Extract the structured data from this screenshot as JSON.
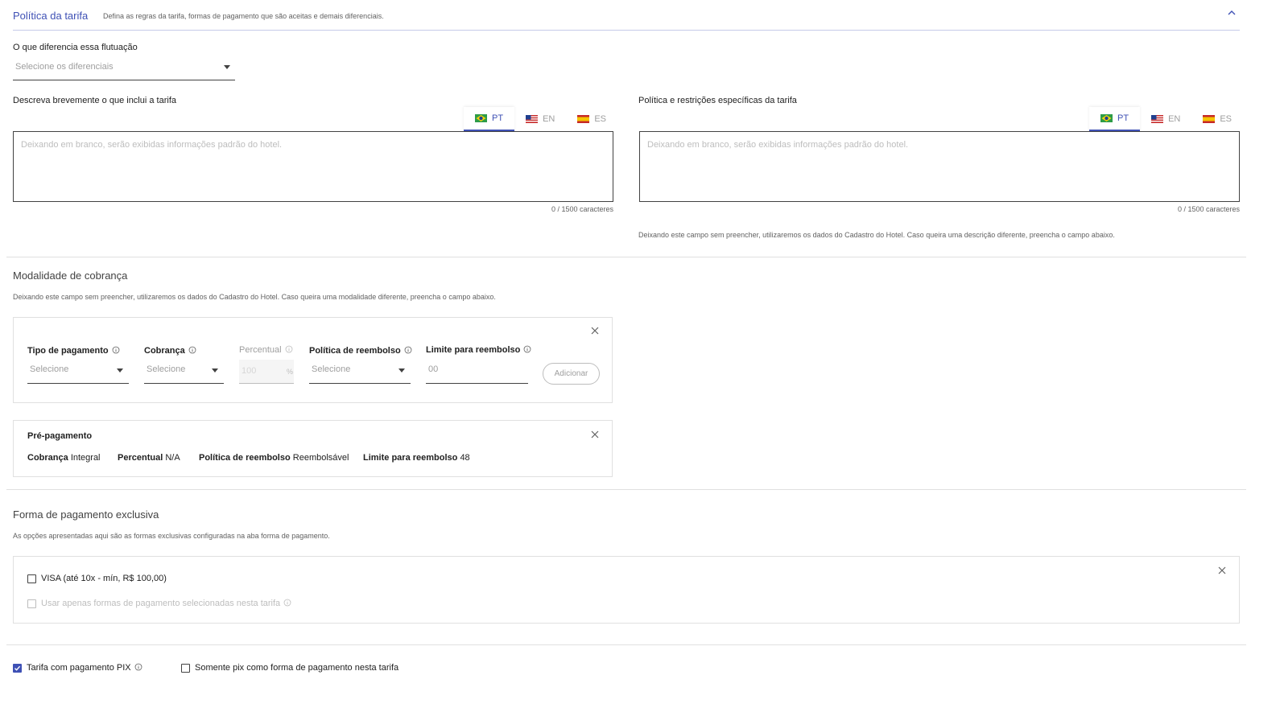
{
  "section": {
    "title": "Política da tarifa",
    "description": "Defina as regras da tarifa, formas de pagamento que são aceitas e demais diferenciais."
  },
  "diferenciais": {
    "label": "O que diferencia essa flutuação",
    "placeholder": "Selecione os diferenciais"
  },
  "descricao": {
    "label": "Descreva brevemente o que inclui a tarifa",
    "placeholder": "Deixando em branco, serão exibidas informações padrão do hotel.",
    "counter": "0 / 1500 caracteres"
  },
  "politica": {
    "label": "Política e restrições específicas da tarifa",
    "placeholder": "Deixando em branco, serão exibidas informações padrão do hotel.",
    "counter": "0 / 1500 caracteres",
    "note": "Deixando este campo sem preencher, utilizaremos os dados do Cadastro do Hotel. Caso queira uma descrição diferente, preencha o campo abaixo."
  },
  "languages": [
    {
      "code": "PT",
      "active": true
    },
    {
      "code": "EN",
      "active": false
    },
    {
      "code": "ES",
      "active": false
    }
  ],
  "modalidade": {
    "title": "Modalidade de cobrança",
    "note": "Deixando este campo sem preencher, utilizaremos os dados do Cadastro do Hotel. Caso queira uma modalidade diferente, preencha o campo abaixo.",
    "form": {
      "tipo_label": "Tipo de pagamento",
      "tipo_placeholder": "Selecione",
      "cobranca_label": "Cobrança",
      "cobranca_placeholder": "Selecione",
      "percentual_label": "Percentual",
      "percentual_value": "100",
      "percentual_unit": "%",
      "reembolso_label": "Política de reembolso",
      "reembolso_placeholder": "Selecione",
      "limite_label": "Limite para reembolso",
      "limite_placeholder": "00",
      "add_button": "Adicionar"
    },
    "item": {
      "title": "Pré-pagamento",
      "cobranca_key": "Cobrança",
      "cobranca_value": "Integral",
      "percentual_key": "Percentual",
      "percentual_value": "N/A",
      "reembolso_key": "Política de reembolso",
      "reembolso_value": "Reembolsável",
      "limite_key": "Limite para reembolso",
      "limite_value": "48"
    }
  },
  "forma_pagamento": {
    "title": "Forma de pagamento exclusiva",
    "note": "As opções apresentadas aqui são as formas exclusivas configuradas na aba forma de pagamento.",
    "visa_label": "VISA (até 10x - mín, R$ 100,00)",
    "usar_apenas_label": "Usar apenas formas de pagamento selecionadas nesta tarifa"
  },
  "pix": {
    "tarifa_pix_label": "Tarifa com pagamento PIX",
    "tarifa_pix_checked": true,
    "somente_pix_label": "Somente pix como forma de pagamento nesta tarifa",
    "somente_pix_checked": false
  },
  "colors": {
    "accent": "#3f51b5",
    "text": "#212121",
    "muted": "#9e9e9e",
    "border": "#e0e0e0"
  }
}
